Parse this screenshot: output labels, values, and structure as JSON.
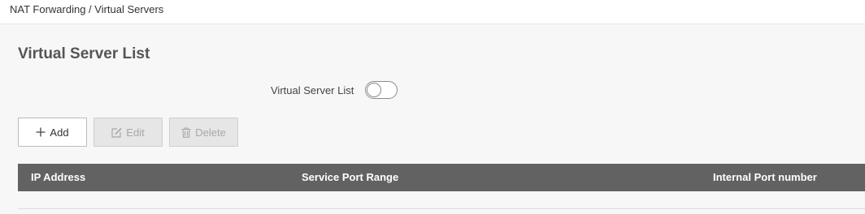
{
  "breadcrumb": "NAT Forwarding / Virtual Servers",
  "page_title": "Virtual Server List",
  "toggle": {
    "label": "Virtual Server List",
    "state": "off"
  },
  "toolbar": {
    "add_label": "Add",
    "edit_label": "Edit",
    "delete_label": "Delete",
    "add_icon": "plus-icon",
    "edit_icon": "edit-icon",
    "delete_icon": "trash-icon"
  },
  "table": {
    "columns": [
      "IP Address",
      "Service Port Range",
      "Internal Port number"
    ],
    "rows": []
  },
  "colors": {
    "header_bg": "#626262",
    "page_bg": "#f7f7f7",
    "disabled_btn_bg": "#e6e6e6"
  }
}
